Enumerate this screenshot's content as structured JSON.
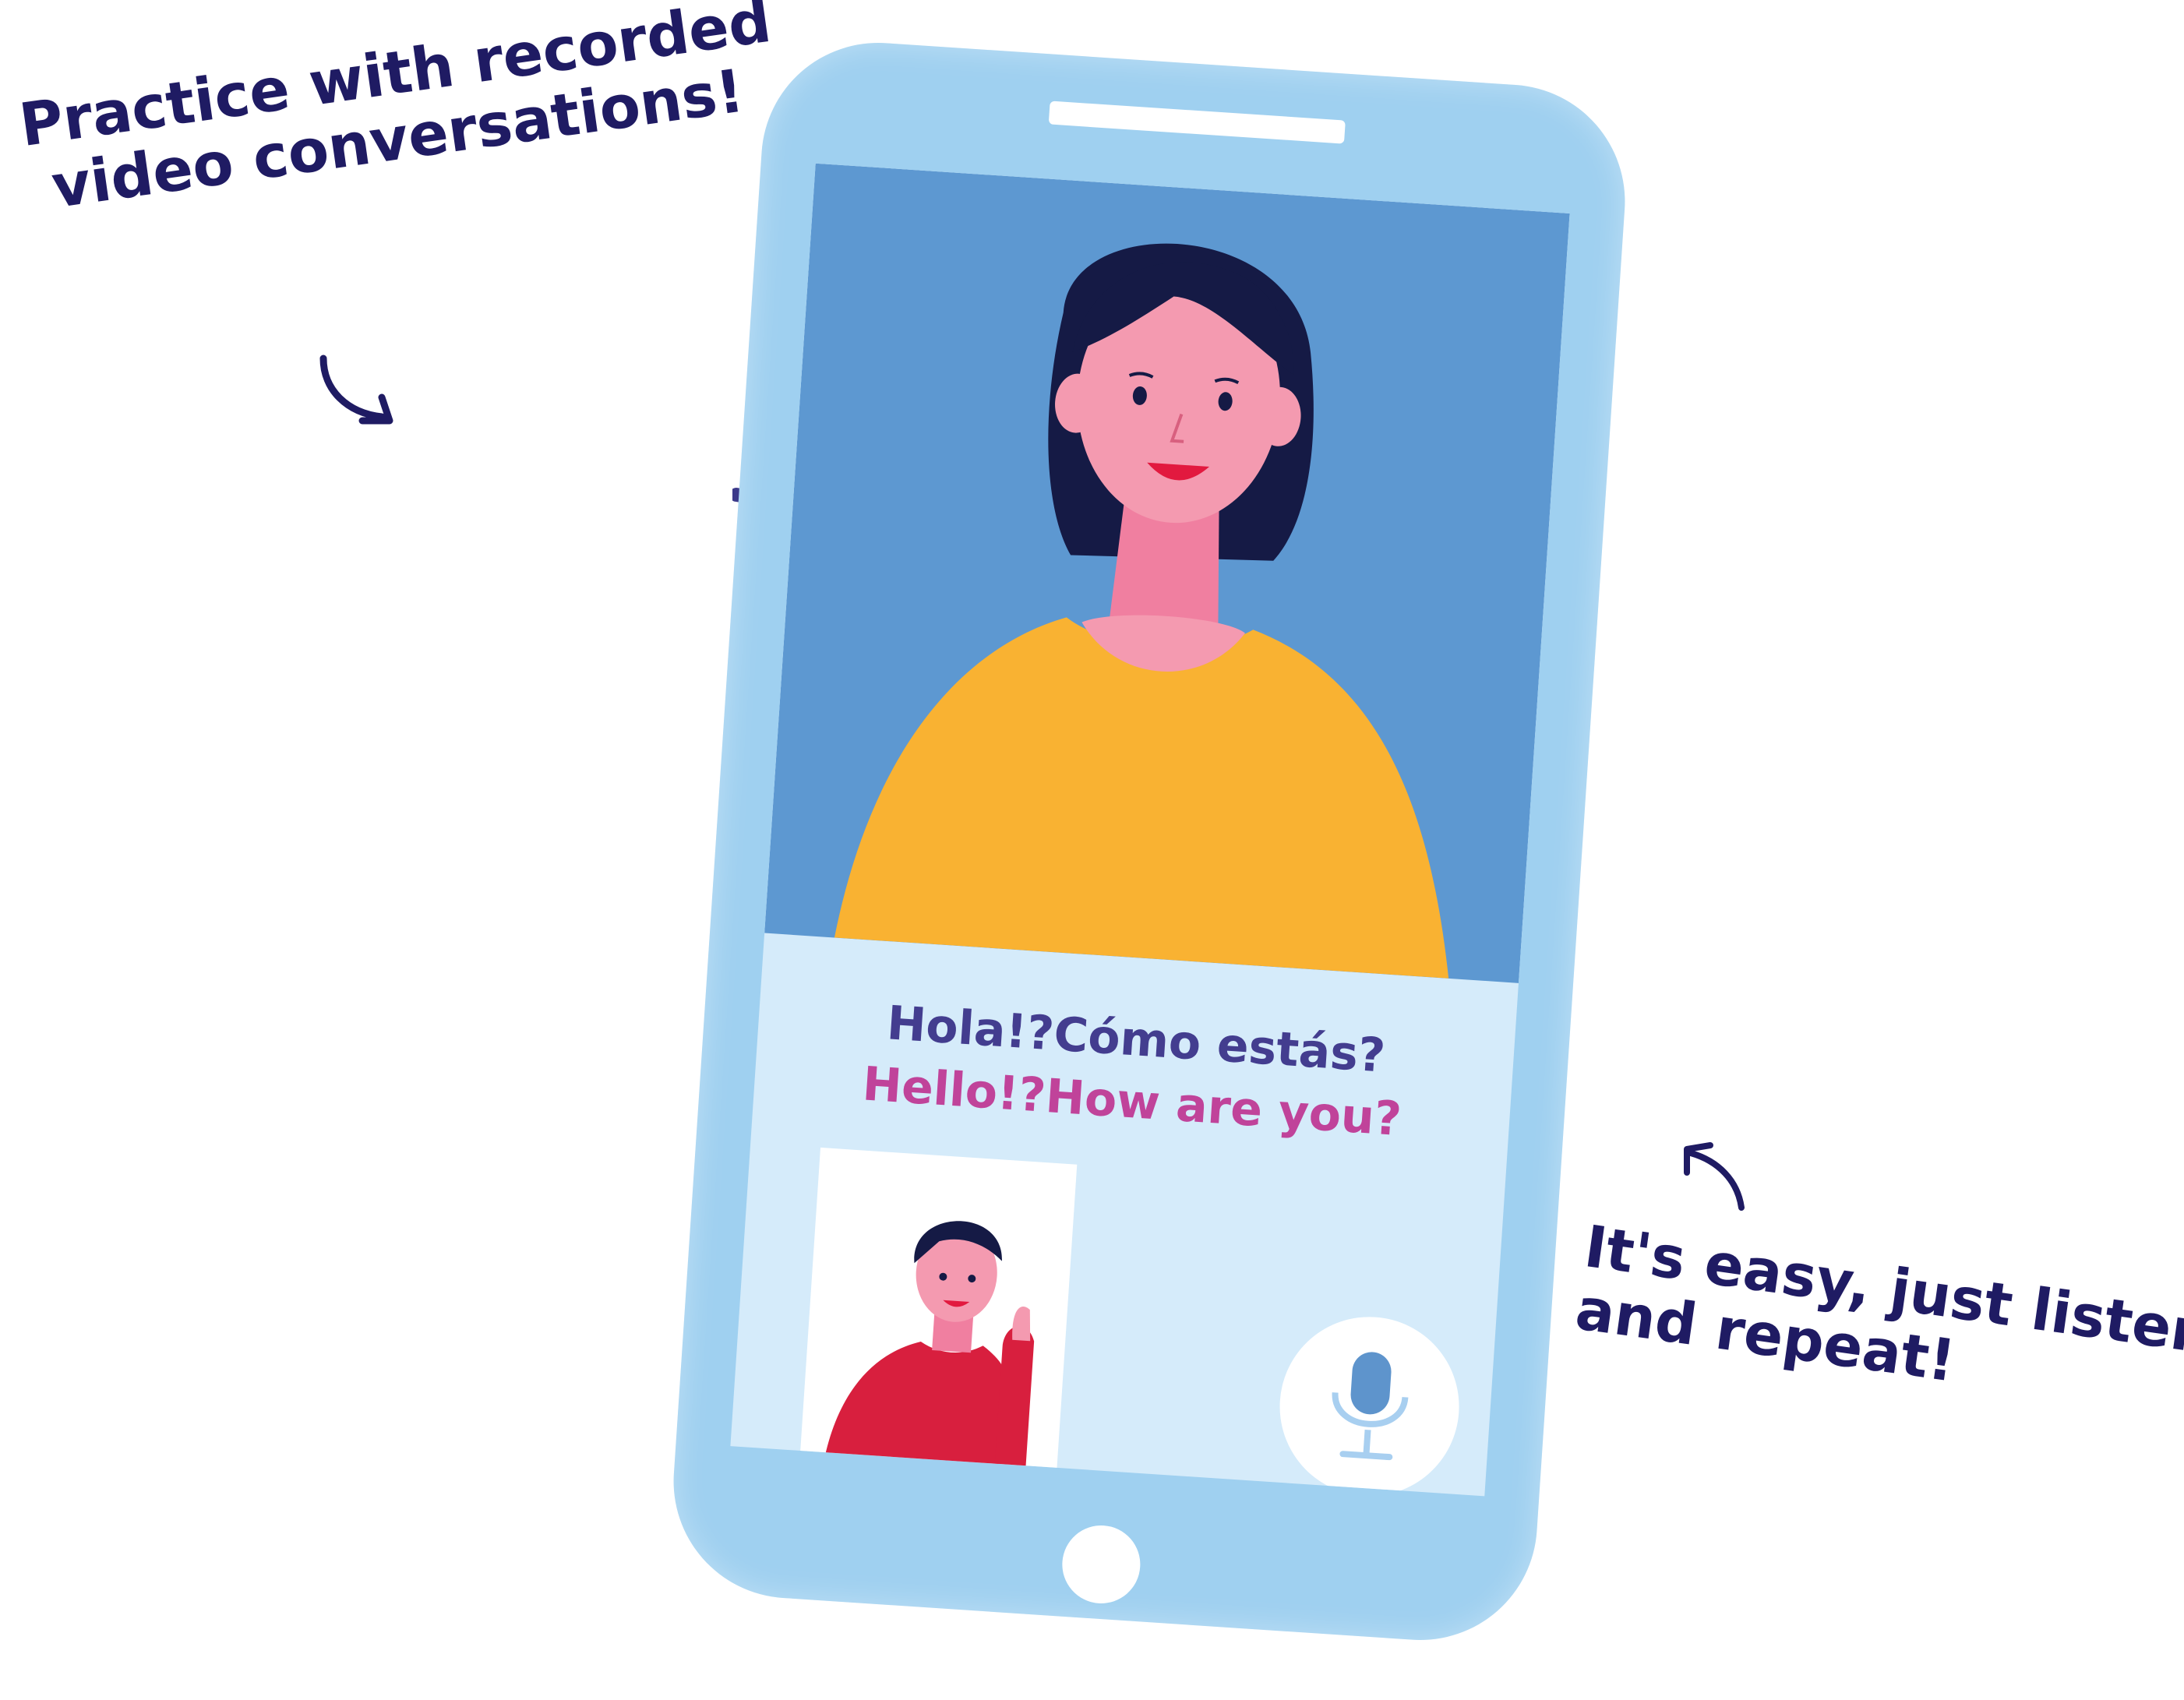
{
  "annotations": {
    "top": {
      "line1": "Practice with recorded",
      "line2": "video conversations!"
    },
    "bottom": {
      "line1": "It's easy, just listen",
      "line2": "and repeat!"
    }
  },
  "subtitles": {
    "spanish": "Hola!?Cómo estás?",
    "english": "Hello!?How are you?"
  },
  "colors": {
    "ink": "#1f1b63",
    "phone_body": "#9fd0f0",
    "video_bg": "#5d98d1",
    "screen_lower": "#d5ebfa",
    "spanish_text": "#433d8f",
    "english_text": "#c0439a",
    "sweater": "#f9b232",
    "skin": "#f49ab0",
    "hair": "#151a45",
    "pip_shirt": "#d81f3e",
    "mic": "#5e94cc"
  },
  "icons": {
    "mic": "microphone-icon",
    "arrows": "arrow-icon"
  }
}
